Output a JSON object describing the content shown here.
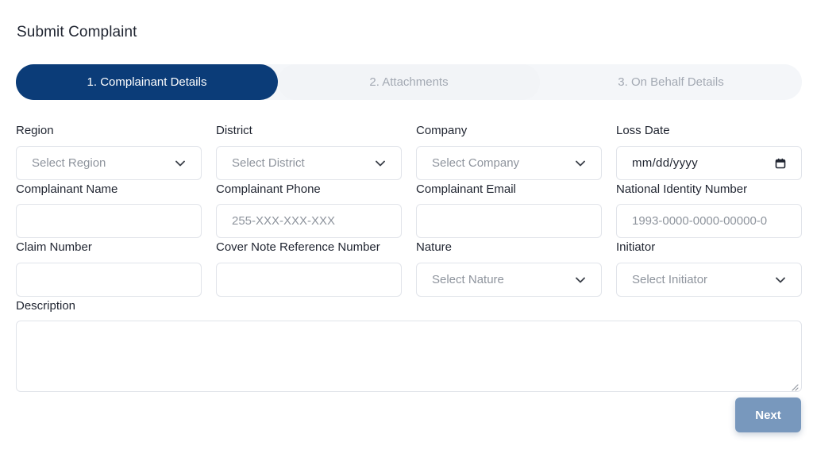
{
  "page": {
    "title": "Submit Complaint"
  },
  "steps": [
    {
      "label": "1. Complainant Details",
      "active": true
    },
    {
      "label": "2. Attachments",
      "active": false
    },
    {
      "label": "3. On Behalf Details",
      "active": false
    }
  ],
  "form": {
    "region": {
      "label": "Region",
      "placeholder": "Select Region"
    },
    "district": {
      "label": "District",
      "placeholder": "Select District"
    },
    "company": {
      "label": "Company",
      "placeholder": "Select Company"
    },
    "loss_date": {
      "label": "Loss Date",
      "placeholder": "mm/dd/yyyy"
    },
    "complainant_name": {
      "label": "Complainant Name",
      "value": ""
    },
    "complainant_phone": {
      "label": "Complainant Phone",
      "placeholder": "255-XXX-XXX-XXX"
    },
    "complainant_email": {
      "label": "Complainant Email",
      "value": ""
    },
    "national_id": {
      "label": "National Identity Number",
      "placeholder": "1993-0000-0000-00000-0"
    },
    "claim_number": {
      "label": "Claim Number",
      "value": ""
    },
    "cover_note": {
      "label": "Cover Note Reference Number",
      "value": ""
    },
    "nature": {
      "label": "Nature",
      "placeholder": "Select Nature"
    },
    "initiator": {
      "label": "Initiator",
      "placeholder": "Select Initiator"
    },
    "description": {
      "label": "Description",
      "value": ""
    }
  },
  "actions": {
    "next_label": "Next"
  },
  "colors": {
    "primary": "#0b3c78",
    "next_button": "#7898bd",
    "border": "#e1e4ea"
  },
  "icons": {
    "select": "chevron-down-icon",
    "date": "calendar-icon",
    "textarea": "resize-handle-icon"
  }
}
